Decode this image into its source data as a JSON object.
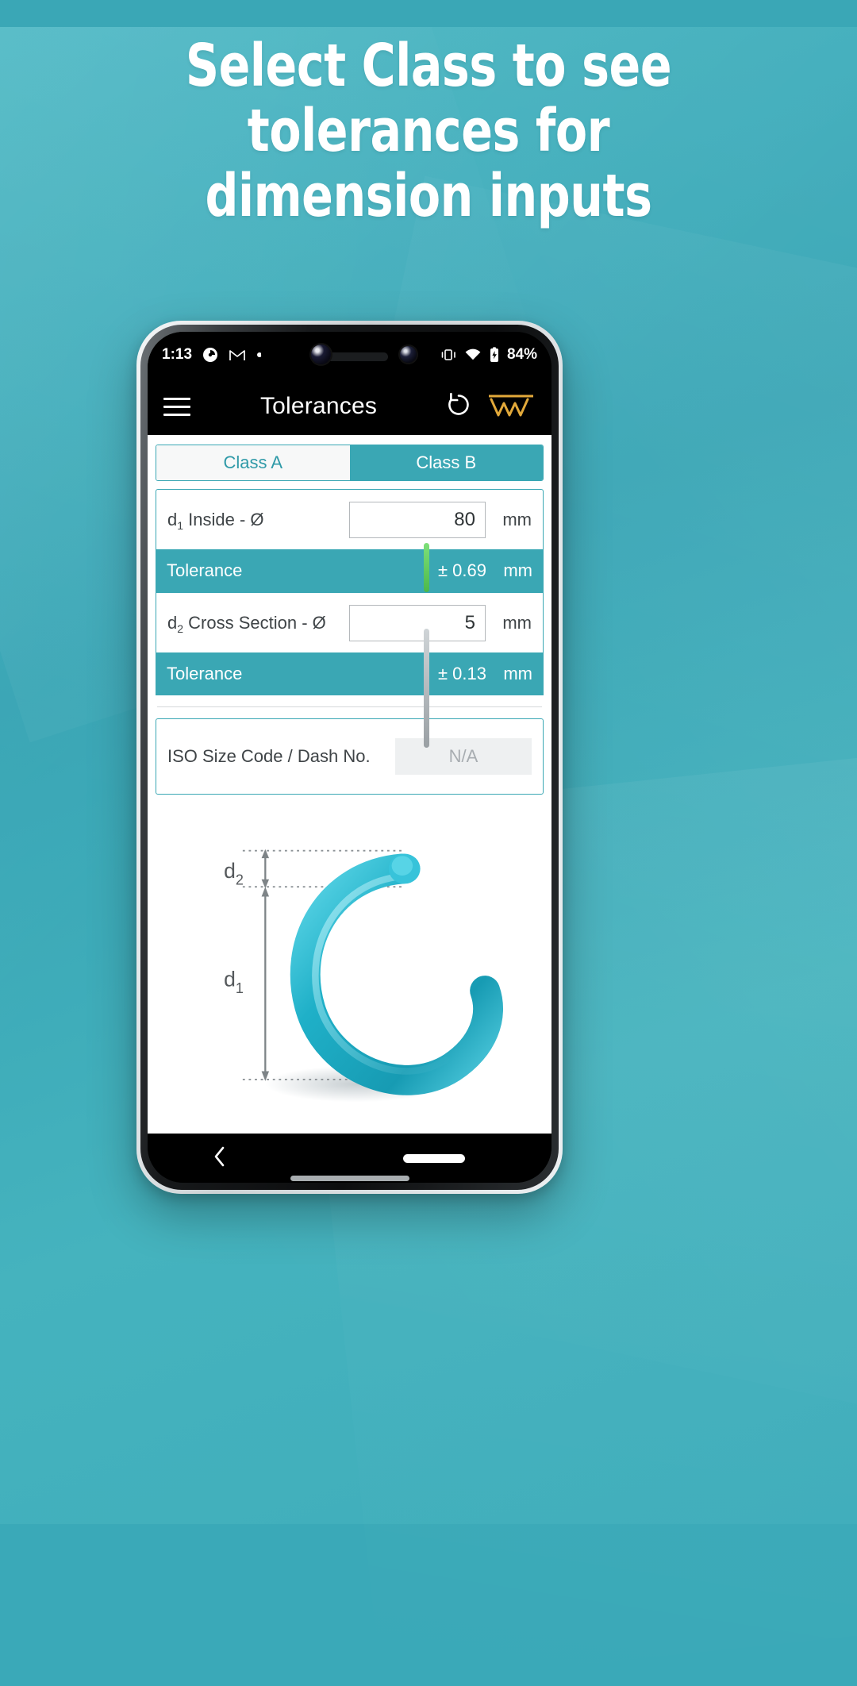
{
  "promo": {
    "headline_lines": [
      "Select Class to see",
      "tolerances for",
      "dimension inputs"
    ],
    "background_color": "#3aa9b8"
  },
  "phone": {
    "status_bar": {
      "time": "1:13",
      "icons_left": [
        "pocketcasts-icon",
        "gmail-icon",
        "dot-icon"
      ],
      "icons_right": [
        "vibrate-icon",
        "wifi-icon",
        "battery-charging-icon"
      ],
      "battery_percent": "84%"
    },
    "app_bar": {
      "menu_icon": "hamburger-menu-icon",
      "title": "Tolerances",
      "reset_icon": "reset-counterclockwise-icon",
      "logo_icon": "www-brand-logo-icon"
    },
    "nav_bar": {
      "back_icon": "chevron-left-icon",
      "home_pill": "home-gesture-pill"
    }
  },
  "app": {
    "accent_color": "#3aa7b4",
    "tabs": [
      {
        "label": "Class A",
        "selected": false
      },
      {
        "label": "Class B",
        "selected": true
      }
    ],
    "fields": [
      {
        "label_prefix": "d",
        "label_sub": "1",
        "label_rest": " Inside - Ø",
        "value": "80",
        "unit": "mm",
        "tolerance_label": "Tolerance",
        "tolerance_value": "± 0.69",
        "tolerance_unit": "mm"
      },
      {
        "label_prefix": "d",
        "label_sub": "2",
        "label_rest": " Cross Section - Ø",
        "value": "5",
        "unit": "mm",
        "tolerance_label": "Tolerance",
        "tolerance_value": "± 0.13",
        "tolerance_unit": "mm"
      }
    ],
    "iso_row": {
      "label": "ISO Size Code / Dash No.",
      "value": "N/A"
    },
    "diagram": {
      "name": "o-ring-dimension-diagram",
      "label_d2_prefix": "d",
      "label_d2_sub": "2",
      "label_d1_prefix": "d",
      "label_d1_sub": "1",
      "ring_color": "#1fb0c8"
    }
  }
}
